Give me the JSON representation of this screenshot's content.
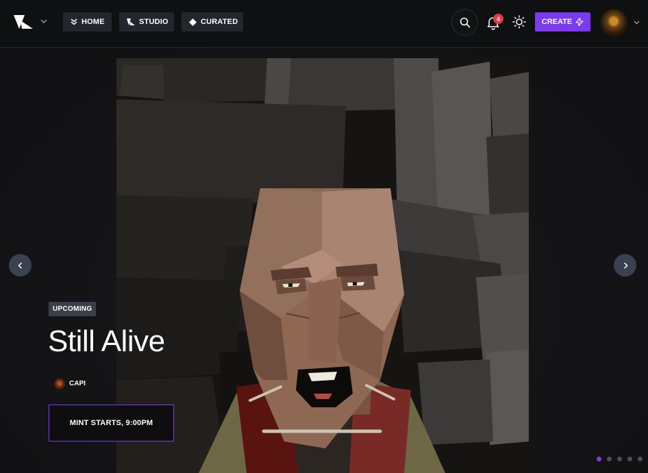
{
  "nav": {
    "home_label": "HOME",
    "studio_label": "STUDIO",
    "curated_label": "CURATED",
    "create_label": "CREATE",
    "notification_count": "4"
  },
  "hero": {
    "status": "UPCOMING",
    "title": "Still Alive",
    "artist": "CAPI",
    "mint_label": "MINT STARTS, 9:00PM",
    "slide_count": 5,
    "active_slide": 1
  },
  "colors": {
    "accent": "#7c3aed",
    "badge_red": "#e63946",
    "background": "#121214"
  },
  "icons": [
    "logo-icon",
    "chevron-down-icon",
    "home-icon",
    "studio-icon",
    "diamond-icon",
    "search-icon",
    "bell-icon",
    "sun-icon",
    "lightning-icon",
    "arrow-left-icon",
    "arrow-right-icon"
  ]
}
